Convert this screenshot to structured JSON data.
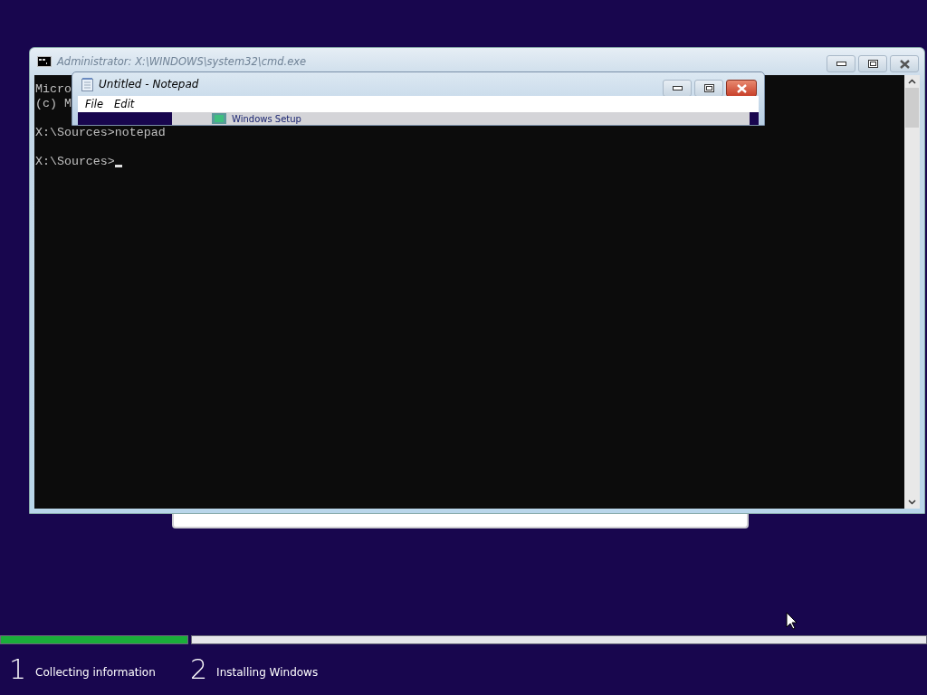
{
  "console_window": {
    "title": "Administrator: X:\\WINDOWS\\system32\\cmd.exe",
    "active": false,
    "lines": [
      {
        "text": "Micro"
      },
      {
        "text": "(c) M"
      },
      {
        "text": "X:\\Sources>notepad",
        "blank_before": true
      },
      {
        "text": "X:\\Sources>",
        "blank_before": true,
        "cursor": true
      }
    ]
  },
  "setup_window": {
    "title": "Windows Setup"
  },
  "notepad_window": {
    "title": "Untitled - Notepad",
    "active": true,
    "menu": [
      "File",
      "Edit"
    ]
  },
  "progress": {
    "steps": [
      {
        "number": "1",
        "label": "Collecting information",
        "level": 1
      },
      {
        "number": "2",
        "label": "Installing Windows"
      }
    ]
  }
}
